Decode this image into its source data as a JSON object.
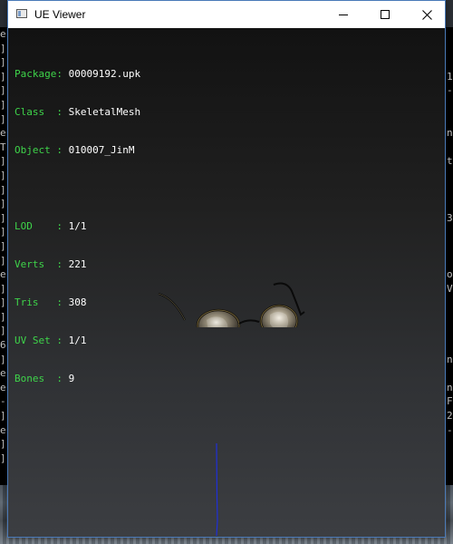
{
  "window": {
    "title": "UE Viewer",
    "buttons": {
      "minimize": "minimize",
      "maximize": "maximize",
      "close": "close"
    }
  },
  "info": {
    "package": {
      "label": "Package:",
      "value": "00009192.upk"
    },
    "class": {
      "label": "Class  :",
      "value": "SkeletalMesh"
    },
    "object": {
      "label": "Object :",
      "value": "010007_JinM"
    },
    "lod": {
      "label": "LOD    :",
      "value": "1/1"
    },
    "verts": {
      "label": "Verts  :",
      "value": "221"
    },
    "tris": {
      "label": "Tris   :",
      "value": "308"
    },
    "uvset": {
      "label": "UV Set :",
      "value": "1/1"
    },
    "bones": {
      "label": "Bones  :",
      "value": "9"
    }
  },
  "background_console": {
    "left": [
      "e",
      "]",
      "]",
      "]",
      "]",
      "]",
      "]",
      "e",
      "T",
      "]",
      "]",
      "]",
      "]",
      "]",
      "]",
      "]",
      "]",
      "e",
      "]",
      "]",
      "]",
      "]",
      "6",
      "]",
      "e",
      "e",
      "-",
      "]",
      "e",
      "]",
      "]"
    ],
    "right": [
      "",
      "",
      "",
      "1",
      "-",
      "",
      "",
      "n",
      "",
      "t",
      "",
      "",
      "",
      "3",
      "",
      "",
      "",
      "o",
      "V",
      "",
      "",
      "",
      "",
      "n",
      "",
      "n",
      "F",
      "2",
      "-",
      "",
      ""
    ]
  },
  "colors": {
    "label": "#3ed44a",
    "value": "#ffffff",
    "axis": "#1f2fd8",
    "viewport_top": "#121212",
    "viewport_bottom": "#3c3e42"
  },
  "icons": [
    "app-icon",
    "minimize-icon",
    "maximize-icon",
    "close-icon"
  ]
}
